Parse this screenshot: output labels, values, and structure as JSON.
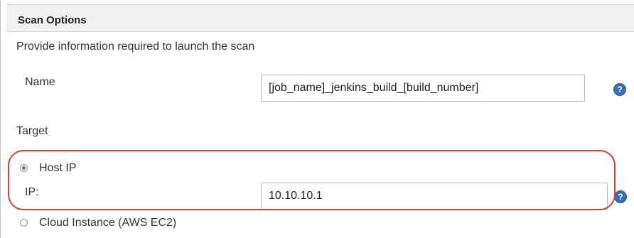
{
  "section": {
    "title": "Scan Options",
    "description": "Provide information required to launch the scan"
  },
  "name_field": {
    "label": "Name",
    "value": "[job_name]_jenkins_build_[build_number]",
    "help_icon": "question-mark-icon"
  },
  "target": {
    "label": "Target",
    "options": [
      {
        "label": "Host IP",
        "selected": true
      },
      {
        "label": "Cloud Instance (AWS EC2)",
        "selected": false
      }
    ],
    "ip_field": {
      "label": "IP:",
      "value": "10.10.10.1",
      "help_icon": "question-mark-icon"
    }
  },
  "colors": {
    "highlight": "#e03a3a",
    "header_bg": "#f0f0f0",
    "help_icon": "#3a6fb5"
  }
}
